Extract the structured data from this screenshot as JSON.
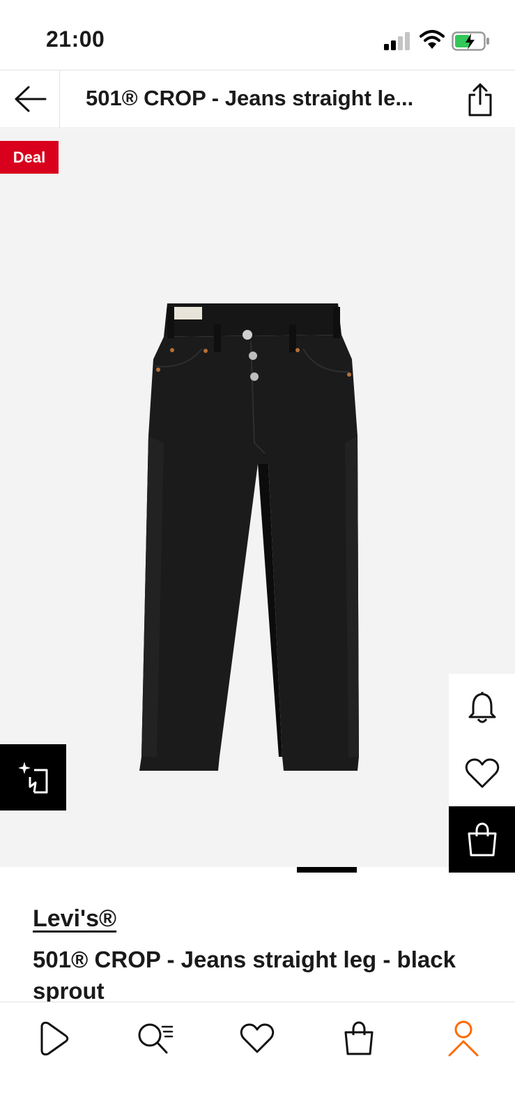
{
  "status_bar": {
    "time": "21:00"
  },
  "header": {
    "title": "501® CROP - Jeans straight le..."
  },
  "image": {
    "badge": "Deal",
    "alt": "black jeans",
    "carousel": {
      "active_index": 1,
      "count": 2
    }
  },
  "product": {
    "brand": "Levi's®",
    "name": "501® CROP - Jeans straight leg - black sprout"
  },
  "icons": {
    "back": "arrow-left-icon",
    "share": "share-icon",
    "similar": "similar-items-icon",
    "notify": "bell-icon",
    "wishlist": "heart-icon",
    "add_to_bag": "bag-icon"
  },
  "bottom_nav": [
    {
      "name": "discover",
      "icon": "play-icon"
    },
    {
      "name": "search",
      "icon": "search-icon"
    },
    {
      "name": "wishlist",
      "icon": "heart-icon"
    },
    {
      "name": "bag",
      "icon": "bag-icon"
    },
    {
      "name": "profile",
      "icon": "person-icon",
      "active": true
    }
  ],
  "colors": {
    "deal": "#d8001d",
    "accent": "#ff6900",
    "text": "#1a1a1a"
  }
}
